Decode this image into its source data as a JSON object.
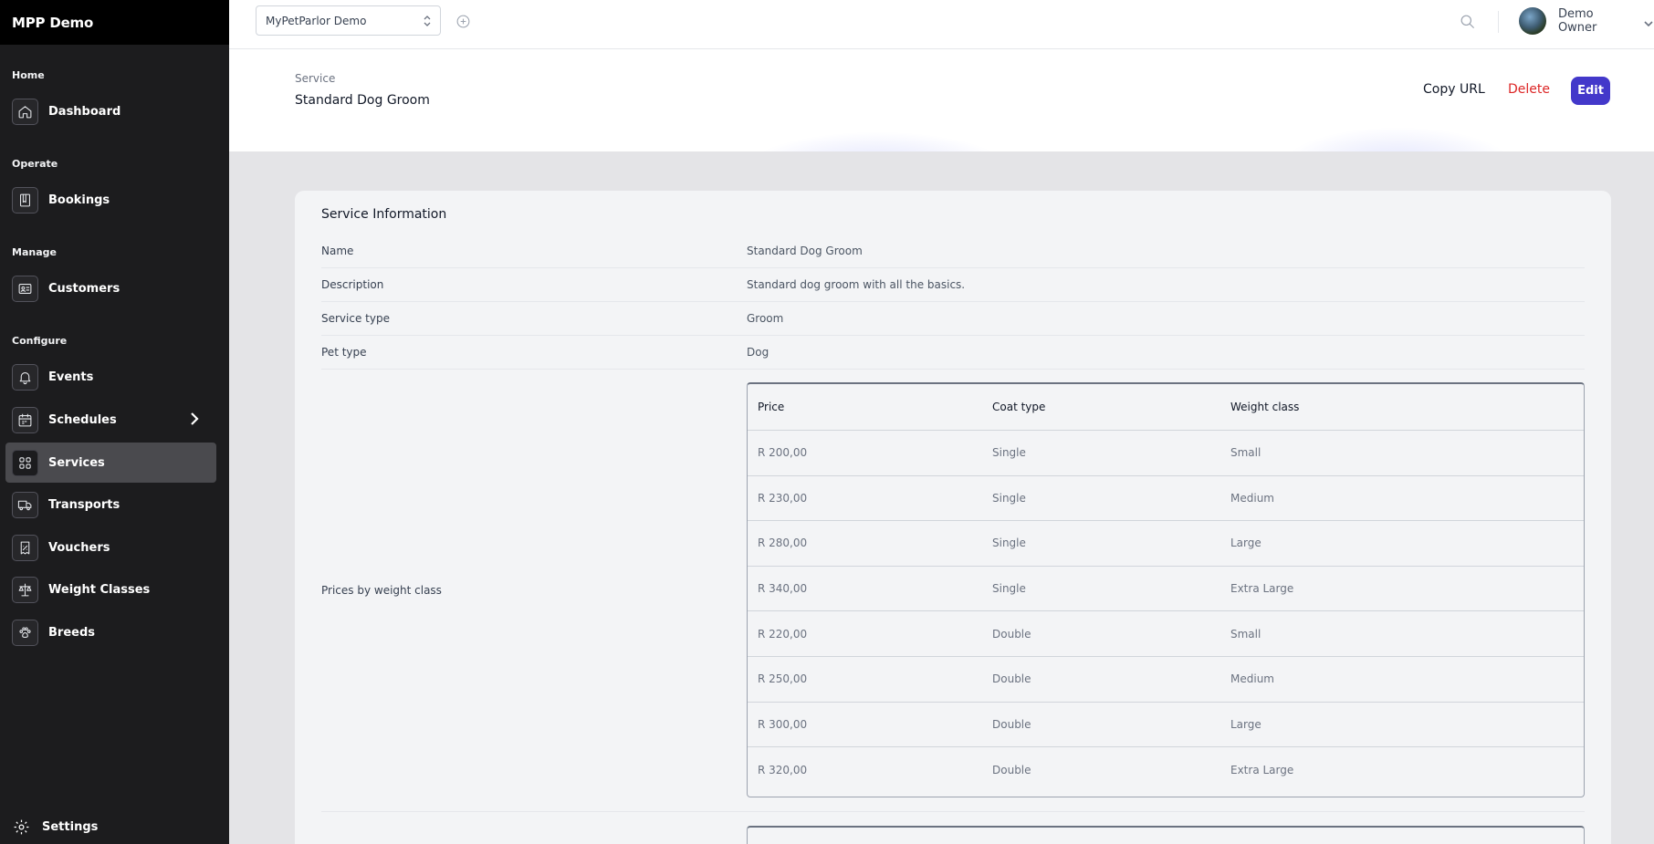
{
  "app": {
    "brand": "MPP Demo"
  },
  "sidebar": {
    "sections": [
      "Home",
      "Operate",
      "Manage",
      "Configure"
    ],
    "items": [
      {
        "label": "Dashboard",
        "icon": "home-icon"
      },
      {
        "label": "Bookings",
        "icon": "book-icon"
      },
      {
        "label": "Customers",
        "icon": "id-card-icon"
      },
      {
        "label": "Events",
        "icon": "bell-icon"
      },
      {
        "label": "Schedules",
        "icon": "calendar-icon"
      },
      {
        "label": "Services",
        "icon": "grid-icon",
        "active": true
      },
      {
        "label": "Transports",
        "icon": "truck-icon"
      },
      {
        "label": "Vouchers",
        "icon": "voucher-icon"
      },
      {
        "label": "Weight Classes",
        "icon": "scale-icon"
      },
      {
        "label": "Breeds",
        "icon": "paw-icon"
      }
    ],
    "settings_label": "Settings"
  },
  "topbar": {
    "org_selected": "MyPetParlor Demo",
    "user_name": "Demo Owner"
  },
  "header": {
    "breadcrumb": "Service",
    "title": "Standard Dog Groom",
    "copy_url": "Copy URL",
    "delete": "Delete",
    "edit": "Edit"
  },
  "card": {
    "title": "Service Information",
    "fields": [
      {
        "key": "Name",
        "value": "Standard Dog Groom"
      },
      {
        "key": "Description",
        "value": "Standard dog groom with all the basics."
      },
      {
        "key": "Service type",
        "value": "Groom"
      },
      {
        "key": "Pet type",
        "value": "Dog"
      }
    ],
    "prices_label": "Prices by weight class",
    "price_table": {
      "headers": [
        "Price",
        "Coat type",
        "Weight class"
      ],
      "rows": [
        [
          "R 200,00",
          "Single",
          "Small"
        ],
        [
          "R 230,00",
          "Single",
          "Medium"
        ],
        [
          "R 280,00",
          "Single",
          "Large"
        ],
        [
          "R 340,00",
          "Single",
          "Extra Large"
        ],
        [
          "R 220,00",
          "Double",
          "Small"
        ],
        [
          "R 250,00",
          "Double",
          "Medium"
        ],
        [
          "R 300,00",
          "Double",
          "Large"
        ],
        [
          "R 320,00",
          "Double",
          "Extra Large"
        ]
      ]
    }
  },
  "colors": {
    "accent": "#4338ca",
    "danger": "#dc2626",
    "sidebar_bg": "#1c1c1e"
  }
}
